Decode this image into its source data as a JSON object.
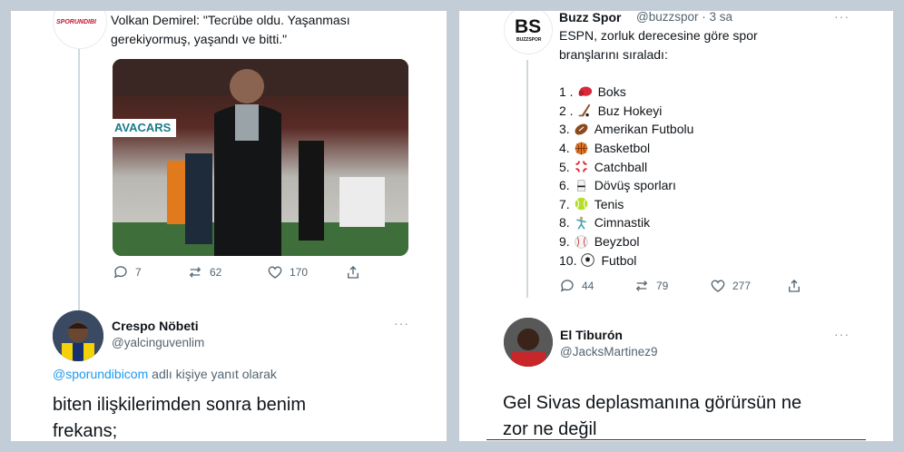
{
  "left": {
    "tweet": {
      "source_logo_text": "SPORUNDIBI",
      "text": "Volkan Demirel: \"Tecrübe oldu. Yaşanması gerekiyormuş, yaşandı ve bitti.\"",
      "image_banner": "AVACARS",
      "actions": {
        "replies": "7",
        "retweets": "62",
        "likes": "170"
      }
    },
    "reply": {
      "name": "Crespo Nöbeti",
      "handle": "@yalcinguvenlim",
      "reply_to_mention": "@sporundibicom",
      "reply_to_suffix": " adlı kişiye yanıt olarak",
      "text_line1": "biten ilişkilerimden sonra benim",
      "text_line2": "frekans;"
    }
  },
  "right": {
    "tweet": {
      "logo": "BS",
      "logo_sub": "BUZZSPOR",
      "name": "Buzz Spor",
      "handle": "@buzzspor · 3 sa",
      "text_line1": "ESPN, zorluk derecesine göre spor",
      "text_line2": "branşlarını sıraladı:",
      "ranking": [
        {
          "num": "1 .",
          "sport": "Boks",
          "icon": "boxing-glove-icon"
        },
        {
          "num": "2 .",
          "sport": "Buz Hokeyi",
          "icon": "hockey-stick-icon"
        },
        {
          "num": "3.",
          "sport": "Amerikan Futbolu",
          "icon": "american-football-icon"
        },
        {
          "num": "4.",
          "sport": "Basketbol",
          "icon": "basketball-icon"
        },
        {
          "num": "5.",
          "sport": "Catchball",
          "icon": "anger-symbol-icon"
        },
        {
          "num": "6.",
          "sport": "Dövüş sporları",
          "icon": "martial-arts-icon"
        },
        {
          "num": "7.",
          "sport": "Tenis",
          "icon": "tennis-ball-icon"
        },
        {
          "num": "8.",
          "sport": "Cimnastik",
          "icon": "gymnast-icon"
        },
        {
          "num": "9.",
          "sport": "Beyzbol",
          "icon": "baseball-icon"
        },
        {
          "num": "10.",
          "sport": "Futbol",
          "icon": "soccer-ball-icon"
        }
      ],
      "actions": {
        "replies": "44",
        "retweets": "79",
        "likes": "277"
      }
    },
    "reply": {
      "name": "El Tiburón",
      "handle": "@JacksMartinez9",
      "text_line1": "Gel Sivas deplasmanına görürsün ne",
      "text_line2": "zor ne değil"
    }
  },
  "colors": {
    "background": "#c3cdd8",
    "card": "#ffffff",
    "text": "#0f1419",
    "muted": "#536471",
    "link": "#1d9bf0",
    "thread": "#cfd9de"
  },
  "more_icon": "···"
}
